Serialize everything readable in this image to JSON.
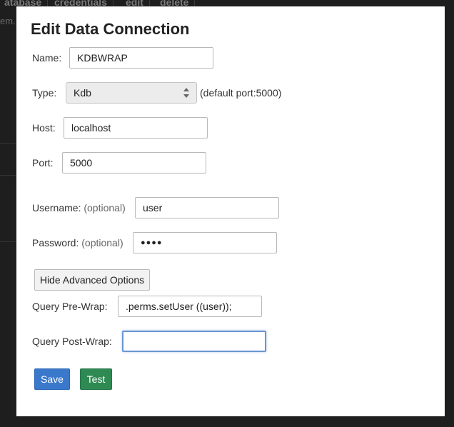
{
  "background": {
    "tabs": [
      "atabase",
      "credentials",
      "edit",
      "delete"
    ],
    "sidebar_text": "em.d"
  },
  "modal": {
    "title": "Edit Data Connection",
    "name": {
      "label": "Name:",
      "value": "KDBWRAP"
    },
    "type": {
      "label": "Type:",
      "value": "Kdb",
      "hint": "(default port:5000)"
    },
    "host": {
      "label": "Host:",
      "value": "localhost"
    },
    "port": {
      "label": "Port:",
      "value": "5000"
    },
    "username": {
      "label": "Username:",
      "optional": "(optional)",
      "value": "user"
    },
    "password": {
      "label": "Password:",
      "optional": "(optional)",
      "value": "●●●●"
    },
    "advanced_toggle_label": "Hide Advanced Options",
    "pre_wrap": {
      "label": "Query Pre-Wrap:",
      "value": ".perms.setUser ((user));"
    },
    "post_wrap": {
      "label": "Query Post-Wrap:",
      "value": ""
    },
    "save_label": "Save",
    "test_label": "Test"
  },
  "colors": {
    "primary": "#3a78cc",
    "success": "#2e8a52",
    "overlay": "#1e1e1e"
  }
}
